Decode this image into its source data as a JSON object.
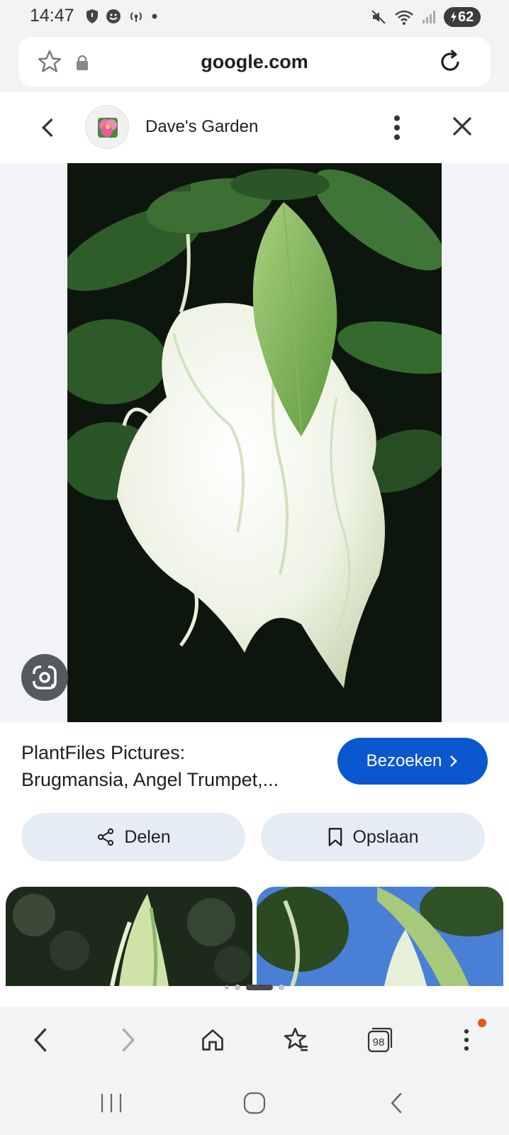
{
  "status_bar": {
    "time": "14:47",
    "battery": "62",
    "left_icons": [
      "shield-icon",
      "messenger-icon",
      "broadcast-icon",
      "dot-icon"
    ],
    "right_icons": [
      "mute-icon",
      "wifi-icon",
      "signal-icon",
      "battery-charging-icon"
    ]
  },
  "url_bar": {
    "domain": "google.com",
    "bookmark_icon": "star-icon",
    "lock_icon": "lock-icon",
    "reload_icon": "reload-icon"
  },
  "site_header": {
    "site_name": "Dave's Garden",
    "back_icon": "chevron-left-icon",
    "menu_icon": "more-vertical-icon",
    "close_icon": "close-icon"
  },
  "image": {
    "subject": "white angel trumpet flower",
    "lens_icon": "google-lens-icon"
  },
  "result": {
    "title_line1": "PlantFiles Pictures:",
    "title_line2": "Brugmansia, Angel Trumpet,...",
    "visit_label": "Bezoeken",
    "share_label": "Delen",
    "save_label": "Opslaan"
  },
  "carousel": {
    "dot_count": 4,
    "active_index": 2
  },
  "toolbar": {
    "tabs_count": "98",
    "items": [
      "back-icon",
      "forward-icon",
      "home-icon",
      "bookmarks-icon",
      "tabs-icon",
      "menu-icon"
    ]
  },
  "nav_bar": {
    "items": [
      "recent-apps-icon",
      "home-circle-icon",
      "back-nav-icon"
    ]
  },
  "colors": {
    "accent": "#0b57d0",
    "pill_bg": "#e6ecf6",
    "badge": "#e8590c"
  }
}
